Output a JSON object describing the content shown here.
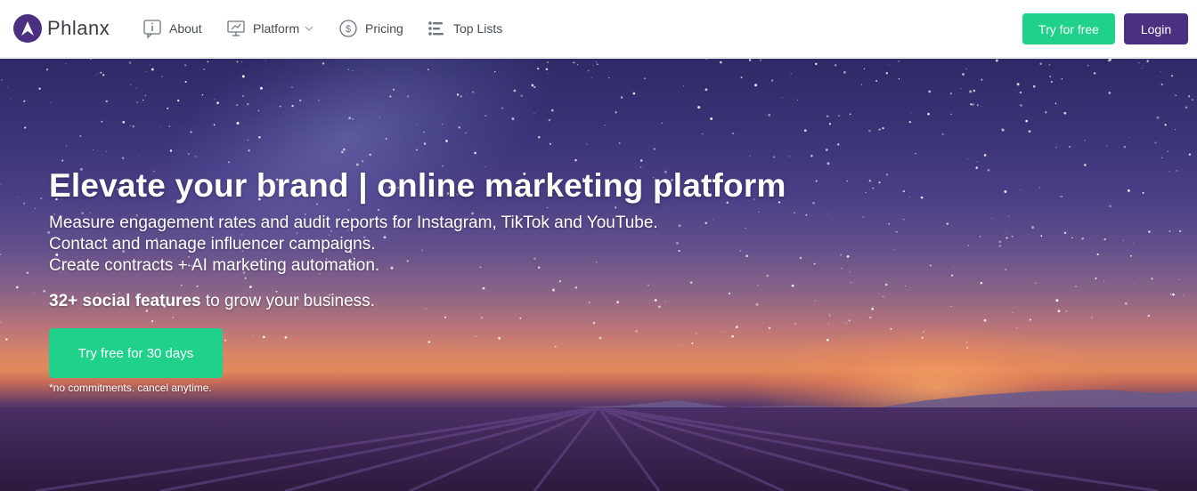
{
  "brand": {
    "name": "Phlanx",
    "logo_icon": "phlanx-logo-icon",
    "color": "#4b2f80"
  },
  "nav": {
    "items": [
      {
        "label": "About",
        "icon": "info-icon"
      },
      {
        "label": "Platform",
        "icon": "monitor-icon",
        "dropdown": true
      },
      {
        "label": "Pricing",
        "icon": "dollar-icon"
      },
      {
        "label": "Top Lists",
        "icon": "list-icon"
      }
    ],
    "try_label": "Try for free",
    "login_label": "Login"
  },
  "hero": {
    "headline": "Elevate your brand | online marketing platform",
    "lines": [
      "Measure engagement rates and audit reports for Instagram, TikTok and YouTube.",
      "Contact and manage influencer campaigns.",
      "Create contracts + AI marketing automation."
    ],
    "features_bold": "32+ social features",
    "features_rest": " to grow your business.",
    "cta_label": "Try free for 30 days",
    "note": "*no commitments. cancel anytime."
  },
  "colors": {
    "accent_green": "#1fd18a",
    "brand_purple": "#4b2f80"
  }
}
